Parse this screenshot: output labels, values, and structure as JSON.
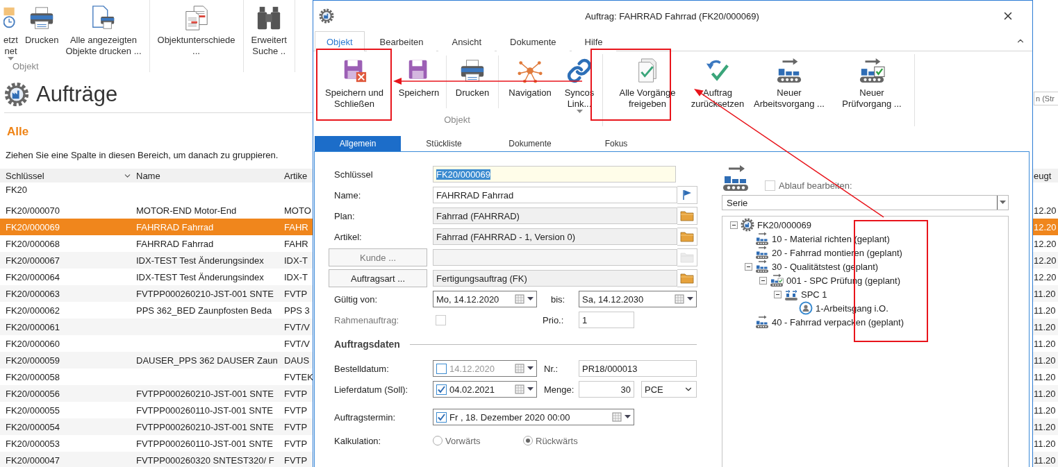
{
  "background": {
    "ribbon": {
      "groups": [
        {
          "label": "Objekt",
          "buttons": [
            {
              "lines": [
                "etzt",
                "net"
              ],
              "dropdown": true
            },
            {
              "lines": [
                "Drucken"
              ],
              "dropdown": false
            },
            {
              "lines": [
                "Alle angezeigten",
                "Objekte drucken ..."
              ],
              "dropdown": false
            }
          ]
        },
        {
          "buttons": [
            {
              "lines": [
                "Objektunterschiede",
                "..."
              ],
              "dropdown": false
            }
          ]
        },
        {
          "buttons": [
            {
              "lines": [
                "Erweitert",
                "Suche .."
              ],
              "dropdown": false
            }
          ]
        }
      ]
    },
    "title": "Aufträge",
    "search": {
      "placeholder": "n (Str"
    },
    "filter": "Alle",
    "group_hint": "Ziehen Sie eine Spalte in diesen Bereich, um danach zu gruppieren.",
    "table": {
      "columns": [
        "Schlüssel",
        "Name",
        "Artike",
        "eugt"
      ],
      "group": "FK20",
      "rows": [
        {
          "key": "FK20/000070",
          "name": "MOTOR-END Motor-End",
          "article": "MOTO",
          "created": "12.20",
          "selected": false
        },
        {
          "key": "FK20/000069",
          "name": "FAHRRAD Fahrrad",
          "article": "FAHR",
          "created": "12.20",
          "selected": true
        },
        {
          "key": "FK20/000068",
          "name": "FAHRRAD Fahrrad",
          "article": "FAHR",
          "created": "12.20",
          "selected": false
        },
        {
          "key": "FK20/000067",
          "name": "IDX-TEST Test Änderungsindex",
          "article": "IDX-T",
          "created": "12.20",
          "selected": false
        },
        {
          "key": "FK20/000064",
          "name": "IDX-TEST Test Änderungsindex",
          "article": "IDX-T",
          "created": "12.20",
          "selected": false
        },
        {
          "key": "FK20/000063",
          "name": "FVTPP000260210-JST-001 SNTE",
          "article": "FVTP",
          "created": "11.20",
          "selected": false
        },
        {
          "key": "FK20/000062",
          "name": "PPS 362_BED Zaunpfosten Beda",
          "article": "PPS 3",
          "created": "11.20",
          "selected": false
        },
        {
          "key": "FK20/000061",
          "article": "FVT/V",
          "created": "11.20",
          "selected": false
        },
        {
          "key": "FK20/000060",
          "article": "FVT/V",
          "created": "11.20",
          "selected": false
        },
        {
          "key": "FK20/000059",
          "name": "DAUSER_PPS 362 DAUSER Zaun",
          "article": "DAUS",
          "created": "11.20",
          "selected": false
        },
        {
          "key": "FK20/000058",
          "article": "FVTEK",
          "created": "11.20",
          "selected": false
        },
        {
          "key": "FK20/000056",
          "name": "FVTPP000260210-JST-001 SNTE",
          "article": "FVTP",
          "created": "11.20",
          "selected": false
        },
        {
          "key": "FK20/000055",
          "name": "FVTPP000260110-JST-001 SNTE",
          "article": "FVTP",
          "created": "11.20",
          "selected": false
        },
        {
          "key": "FK20/000054",
          "name": "FVTPP000260210-JST-001 SNTE",
          "article": "FVTP",
          "created": "11.20",
          "selected": false
        },
        {
          "key": "FK20/000053",
          "name": "FVTPP000260110-JST-001 SNTE",
          "article": "FVTP",
          "created": "11.20",
          "selected": false
        },
        {
          "key": "FK20/000047",
          "name": "FVTPP000260320 SNTEST320/ F",
          "article": "FVTP",
          "created": "11.20",
          "selected": false
        }
      ]
    }
  },
  "dialog": {
    "title": "Auftrag: FAHRRAD Fahrrad (FK20/000069)",
    "menu_tabs": [
      {
        "label": "Objekt",
        "selected": true
      },
      {
        "label": "Bearbeiten",
        "selected": false
      },
      {
        "label": "Ansicht",
        "selected": false
      },
      {
        "label": "Dokumente",
        "selected": false
      },
      {
        "label": "Hilfe",
        "selected": false
      }
    ],
    "ribbon": {
      "groups": [
        {
          "label": "Objekt",
          "buttons": [
            {
              "lines": [
                "Speichern und",
                "Schließen"
              ],
              "dropdown": false
            },
            {
              "lines": [
                "Speichern"
              ],
              "dropdown": false
            },
            {
              "lines": [
                "Drucken"
              ],
              "dropdown": false
            },
            {
              "lines": [
                "Navigation"
              ],
              "dropdown": false
            },
            {
              "lines": [
                "Syncos",
                "Link..."
              ],
              "dropdown": true
            }
          ]
        },
        {
          "buttons": [
            {
              "lines": [
                "Alle Vorgänge",
                "freigeben"
              ],
              "dropdown": false
            },
            {
              "lines": [
                "Auftrag",
                "zurücksetzen"
              ],
              "dropdown": false
            },
            {
              "lines": [
                "Neuer",
                "Arbeitsvorgang ..."
              ],
              "dropdown": false
            },
            {
              "lines": [
                "Neuer",
                "Prüfvorgang ..."
              ],
              "dropdown": false
            }
          ]
        }
      ]
    },
    "tabs": [
      {
        "label": "Allgemein",
        "selected": true
      },
      {
        "label": "Stückliste",
        "selected": false
      },
      {
        "label": "Dokumente",
        "selected": false
      },
      {
        "label": "Fokus",
        "selected": false
      }
    ],
    "general": {
      "key": {
        "label": "Schlüssel",
        "value": "FK20/000069"
      },
      "name": {
        "label": "Name:",
        "value": "FAHRRAD Fahrrad"
      },
      "plan": {
        "label": "Plan:",
        "value": "Fahrrad (FAHRRAD)"
      },
      "article": {
        "label": "Artikel:",
        "value": "Fahrrad (FAHRRAD - 1, Version 0)"
      },
      "customer": {
        "button": "Kunde ...",
        "disabled": true
      },
      "order_type": {
        "button": "Auftragsart ...",
        "value": "Fertigungsauftrag (FK)",
        "disabled": false
      },
      "valid_from": {
        "label": "Gültig von:",
        "value": "Mo, 14.12.2020"
      },
      "valid_to": {
        "label": "bis:",
        "value": "Sa, 14.12.2030"
      },
      "frame_order": {
        "label": "Rahmenauftrag:",
        "checked": false,
        "disabled": true
      },
      "priority": {
        "label": "Prio.:",
        "value": "1"
      }
    },
    "order_data": {
      "title": "Auftragsdaten",
      "order_date": {
        "label": "Bestelldatum:",
        "checked": false,
        "value": "14.12.2020"
      },
      "number": {
        "label": "Nr.:",
        "value": "PR18/000013"
      },
      "delivery_date": {
        "label": "Lieferdatum (Soll):",
        "checked": true,
        "value": "04.02.2021"
      },
      "quantity": {
        "label": "Menge:",
        "value": "30"
      },
      "unit": {
        "value": "PCE"
      },
      "order_deadline": {
        "label": "Auftragstermin:",
        "checked": true,
        "value": "Fr , 18. Dezember 2020 00:00"
      },
      "calculation": {
        "label": "Kalkulation:",
        "options": [
          {
            "label": "Vorwärts",
            "selected": false
          },
          {
            "label": "Rückwärts",
            "selected": true
          }
        ]
      }
    },
    "sequence": {
      "edit": {
        "label": "Ablauf bearbeiten:",
        "checked": false
      },
      "variant": "Serie",
      "tree": [
        {
          "label": "FK20/000069",
          "kind": "order",
          "expanded": true,
          "children": [
            {
              "label": "10 - Material richten (geplant)",
              "kind": "operation"
            },
            {
              "label": "20 - Fahrrad montieren (geplant)",
              "kind": "operation"
            },
            {
              "label": "30 - Qualitätstest (geplant)",
              "kind": "operation",
              "expanded": true,
              "children": [
                {
                  "label": "001 - SPC Prüfung (geplant)",
                  "kind": "inspection",
                  "expanded": true,
                  "children": [
                    {
                      "label": "SPC 1",
                      "kind": "spc",
                      "expanded": true,
                      "children": [
                        {
                          "label": "1-Arbeitsgang i.O.",
                          "kind": "step"
                        }
                      ]
                    }
                  ]
                }
              ]
            },
            {
              "label": "40 - Fahrrad verpacken (geplant)",
              "kind": "operation"
            }
          ]
        }
      ]
    }
  }
}
